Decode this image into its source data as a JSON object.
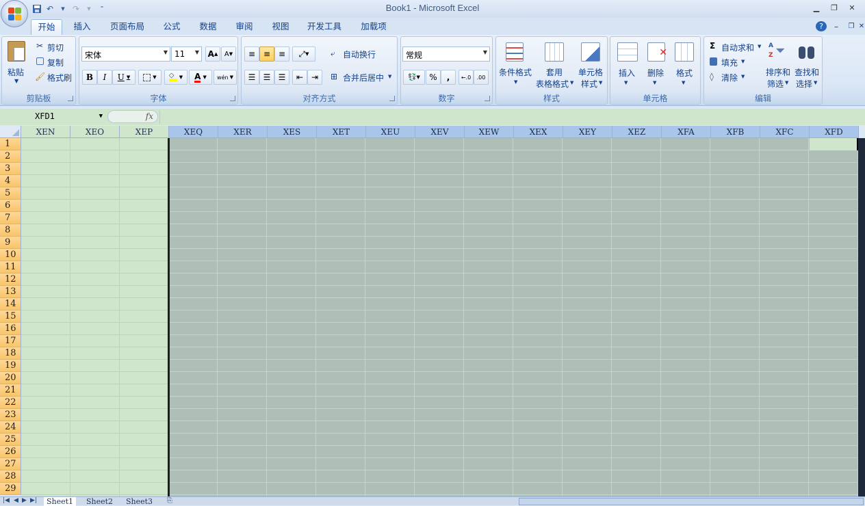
{
  "window": {
    "title": "Book1 - Microsoft Excel"
  },
  "qat": {
    "save_icon": "save-icon",
    "undo_icon": "undo-icon",
    "redo_icon": "redo-icon",
    "more_icon": "customize-icon"
  },
  "tabs": [
    {
      "label": "开始",
      "active": true
    },
    {
      "label": "插入"
    },
    {
      "label": "页面布局"
    },
    {
      "label": "公式"
    },
    {
      "label": "数据"
    },
    {
      "label": "审阅"
    },
    {
      "label": "视图"
    },
    {
      "label": "开发工具"
    },
    {
      "label": "加载项"
    }
  ],
  "clipboard": {
    "label": "剪贴板",
    "paste": "粘贴",
    "cut": "剪切",
    "copy": "复制",
    "format_painter": "格式刷"
  },
  "font": {
    "label": "字体",
    "name": "宋体",
    "size": "11",
    "bold": "B",
    "italic": "I",
    "underline": "U",
    "grow": "A",
    "shrink": "A",
    "font_color": "A",
    "phonetic": "wén"
  },
  "alignment": {
    "label": "对齐方式",
    "wrap": "自动换行",
    "merge": "合并后居中"
  },
  "number": {
    "label": "数字",
    "format": "常规",
    "percent": "%",
    "comma": ","
  },
  "styles": {
    "label": "样式",
    "conditional": "条件格式",
    "table_line1": "套用",
    "table_line2": "表格格式",
    "cell_line1": "单元格",
    "cell_line2": "样式"
  },
  "cells": {
    "label": "单元格",
    "insert": "插入",
    "delete": "删除",
    "format": "格式"
  },
  "editing": {
    "label": "编辑",
    "autosum": "自动求和",
    "fill": "填充",
    "clear": "清除",
    "sort_line1": "排序和",
    "sort_line2": "筛选",
    "find_line1": "查找和",
    "find_line2": "选择"
  },
  "formula_bar": {
    "name_box": "XFD1",
    "fx": "fx",
    "value": ""
  },
  "columns": [
    "XEN",
    "XEO",
    "XEP",
    "XEQ",
    "XER",
    "XES",
    "XET",
    "XEU",
    "XEV",
    "XEW",
    "XEX",
    "XEY",
    "XEZ",
    "XFA",
    "XFB",
    "XFC",
    "XFD"
  ],
  "rows": [
    "1",
    "2",
    "3",
    "4",
    "5",
    "6",
    "7",
    "8",
    "9",
    "10",
    "11",
    "12",
    "13",
    "14",
    "15",
    "16",
    "17",
    "18",
    "19",
    "20",
    "21",
    "22",
    "23",
    "24",
    "25",
    "26",
    "27",
    "28",
    "29"
  ],
  "sheets": [
    "Sheet1",
    "Sheet2",
    "Sheet3"
  ],
  "active_sheet": "Sheet1",
  "colors": {
    "frozen_area": "#cfe5cc",
    "sheet_area": "#adbfb6",
    "header_selected": "#a9c5e9",
    "row_header": "#f7c56b"
  }
}
